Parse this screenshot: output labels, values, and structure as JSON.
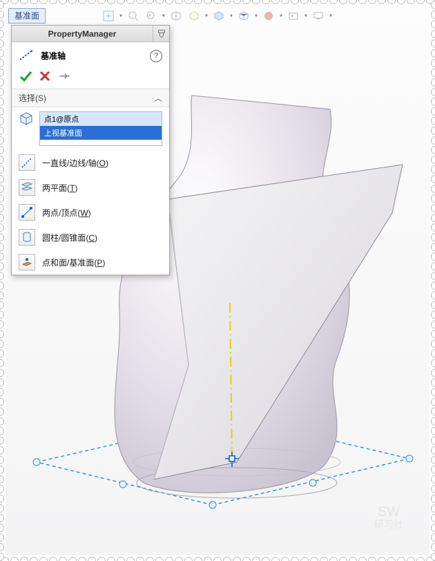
{
  "topTab": {
    "label": "基准面"
  },
  "propertyManager": {
    "title": "PropertyManager",
    "featureName": "基准轴",
    "sectionTitle": "选择(S)",
    "selections": [
      {
        "label": "点1@原点",
        "state": "active"
      },
      {
        "label": "上视基准面",
        "state": "highlight"
      }
    ],
    "options": {
      "line": {
        "label_pre": "一直线/边线/轴(",
        "hot": "O",
        "label_post": ")"
      },
      "planes": {
        "label_pre": "两平面(",
        "hot": "T",
        "label_post": ")"
      },
      "points": {
        "label_pre": "两点/顶点(",
        "hot": "W",
        "label_post": ")"
      },
      "cyl": {
        "label_pre": "圆柱/圆锥面(",
        "hot": "C",
        "label_post": ")"
      },
      "ptface": {
        "label_pre": "点和面/基准面(",
        "hot": "P",
        "label_post": ")"
      }
    }
  },
  "watermark": {
    "line1": "SW",
    "line2": "研习社"
  }
}
